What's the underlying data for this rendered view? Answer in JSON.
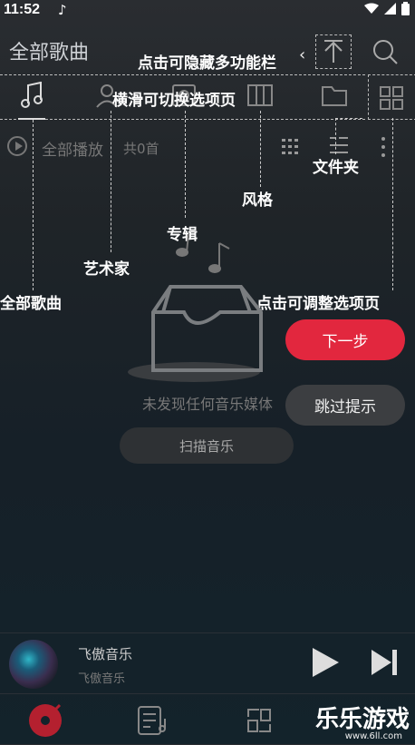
{
  "status": {
    "time": "11:52"
  },
  "header": {
    "title": "全部歌曲"
  },
  "tips": {
    "hide_bar": "点击可隐藏多功能栏",
    "swipe": "横滑可切换选项页",
    "folder": "文件夹",
    "style": "风格",
    "album": "专辑",
    "artist": "艺术家",
    "all_songs": "全部歌曲",
    "adjust": "点击可调整选项页"
  },
  "list": {
    "play_all": "全部播放",
    "count": "共0首"
  },
  "empty": {
    "message": "未发现任何音乐媒体",
    "scan_label": "扫描音乐"
  },
  "guide": {
    "next_label": "下一步",
    "skip_label": "跳过提示"
  },
  "player": {
    "song": "飞傲音乐",
    "artist": "飞傲音乐"
  },
  "watermark": {
    "text": "乐乐游戏",
    "url": "www.6ll.com"
  },
  "colors": {
    "accent": "#e2273e",
    "background": "#1f2428"
  }
}
